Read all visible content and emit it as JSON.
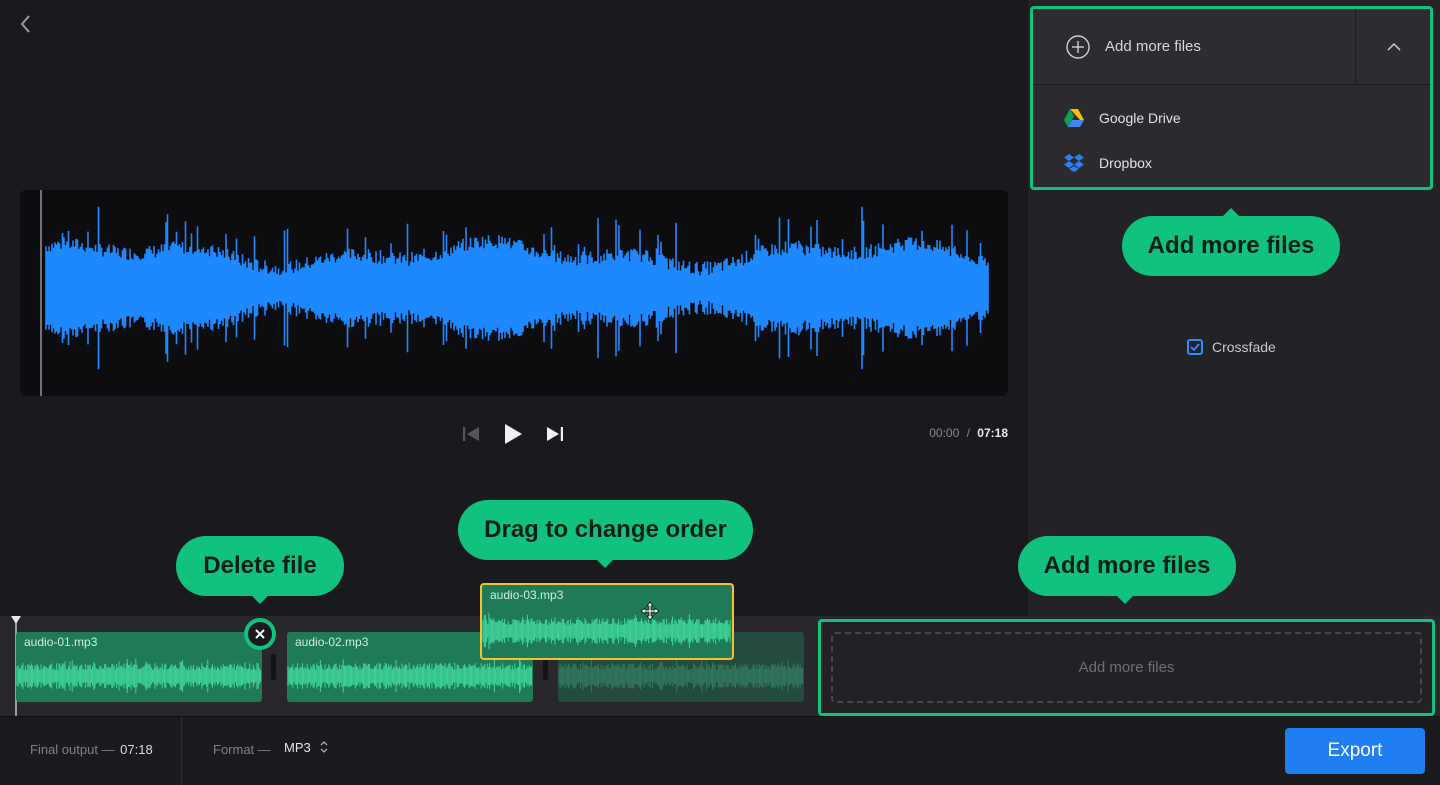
{
  "dropdown": {
    "add_label": "Add more files",
    "items": [
      {
        "label": "Google Drive",
        "icon": "google-drive-icon"
      },
      {
        "label": "Dropbox",
        "icon": "dropbox-icon"
      }
    ]
  },
  "callouts": {
    "add_more_top": "Add more files",
    "add_more_bottom": "Add more files",
    "drag": "Drag to change order",
    "delete": "Delete file"
  },
  "crossfade": {
    "label": "Crossfade",
    "checked": true
  },
  "player": {
    "current": "00:00",
    "separator": "/",
    "total": "07:18"
  },
  "timeline": {
    "clips": [
      {
        "name": "audio-01.mp3"
      },
      {
        "name": "audio-02.mp3"
      },
      {
        "name": "audio-03.mp3"
      }
    ],
    "add_zone": "Add more files"
  },
  "footer": {
    "final_output_label": "Final output —",
    "final_output_value": "07:18",
    "format_label": "Format —",
    "format_value": "MP3",
    "export_label": "Export"
  },
  "colors": {
    "accent": "#10c27e",
    "waveform": "#1e88ff",
    "clip": "#1f7a58",
    "clip_wave": "#3fd79a",
    "export": "#1e7ef2",
    "drag_highlight": "#f2c230"
  }
}
